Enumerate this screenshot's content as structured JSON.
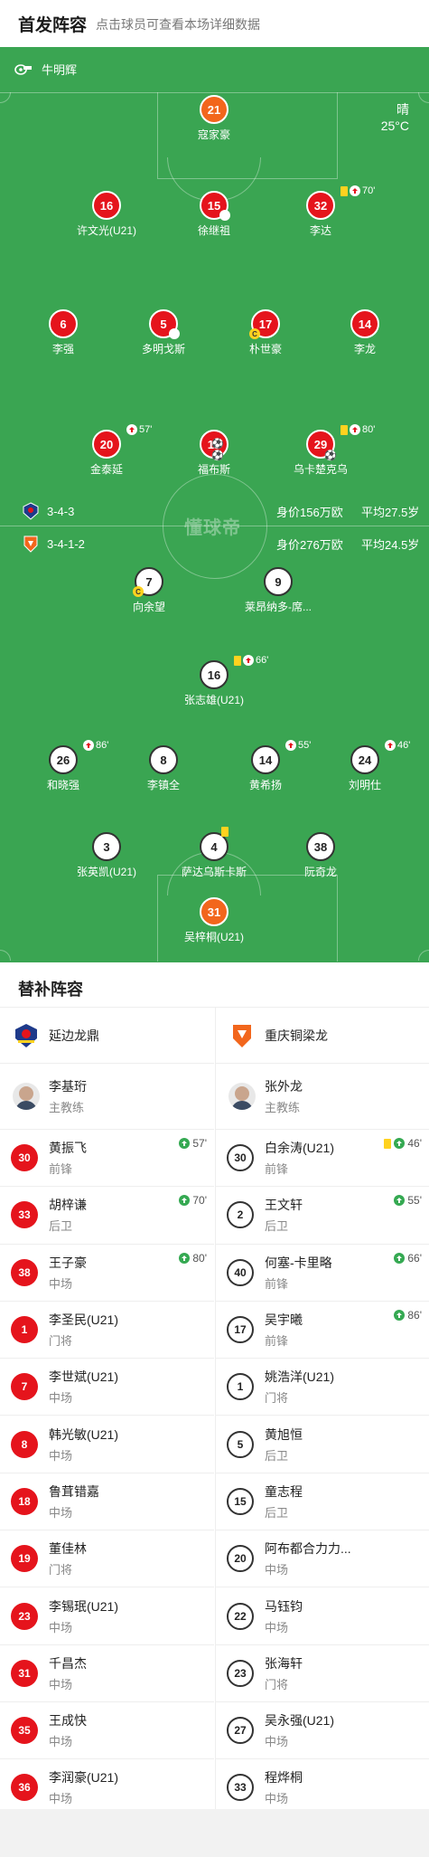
{
  "header": {
    "title": "首发阵容",
    "subtitle": "点击球员可查看本场详细数据"
  },
  "pitch": {
    "referee": "牛明辉",
    "weather": "晴",
    "temperature": "25°C",
    "watermark": "懂球帝",
    "home_team": {
      "formation": "3-4-3",
      "value": "身价156万欧",
      "age": "平均27.5岁"
    },
    "away_team": {
      "formation": "3-4-1-2",
      "value": "身价276万欧",
      "age": "平均24.5岁"
    }
  },
  "home_lineup": [
    {
      "num": "21",
      "name": "寇家豪",
      "color": "orange"
    },
    {
      "num": "16",
      "name": "许文光(U21)",
      "color": "red"
    },
    {
      "num": "15",
      "name": "徐继祖",
      "color": "red",
      "sub_mark": true
    },
    {
      "num": "32",
      "name": "李达",
      "color": "red",
      "yellow": true,
      "sub_time": "70'"
    },
    {
      "num": "6",
      "name": "李强",
      "color": "red"
    },
    {
      "num": "5",
      "name": "多明戈斯",
      "color": "red",
      "sub_mark": true
    },
    {
      "num": "17",
      "name": "朴世豪",
      "color": "red",
      "captain": "C"
    },
    {
      "num": "14",
      "name": "李龙",
      "color": "red"
    },
    {
      "num": "20",
      "name": "金泰延",
      "color": "red",
      "sub_time": "57'"
    },
    {
      "num": "10",
      "name": "福布斯",
      "color": "red",
      "goals": "⚽⚽"
    },
    {
      "num": "29",
      "name": "乌卡楚克乌",
      "color": "red",
      "yellow": true,
      "sub_time": "80'",
      "goals": "⚽"
    }
  ],
  "away_lineup": [
    {
      "num": "7",
      "name": "向余望",
      "captain": "C"
    },
    {
      "num": "9",
      "name": "莱昂纳多-席..."
    },
    {
      "num": "16",
      "name": "张志雄(U21)",
      "yellow": true,
      "sub_time": "66'"
    },
    {
      "num": "26",
      "name": "和晓强",
      "sub_time": "86'"
    },
    {
      "num": "8",
      "name": "李镇全"
    },
    {
      "num": "14",
      "name": "黄希扬",
      "sub_time": "55'"
    },
    {
      "num": "24",
      "name": "刘明仕",
      "sub_time": "46'"
    },
    {
      "num": "3",
      "name": "张英凯(U21)"
    },
    {
      "num": "4",
      "name": "萨达乌斯卡斯",
      "yellow": true
    },
    {
      "num": "38",
      "name": "阮奇龙"
    },
    {
      "num": "31",
      "name": "吴梓桐(U21)",
      "color": "orange"
    }
  ],
  "substitutes": {
    "title": "替补阵容",
    "home": {
      "team": "延边龙鼎",
      "coach": {
        "name": "李基珩",
        "role": "主教练"
      },
      "players": [
        {
          "num": "30",
          "name": "黄振飞",
          "pos": "前锋",
          "in": "57'"
        },
        {
          "num": "33",
          "name": "胡梓谦",
          "pos": "后卫",
          "in": "70'"
        },
        {
          "num": "38",
          "name": "王子豪",
          "pos": "中场",
          "in": "80'"
        },
        {
          "num": "1",
          "name": "李圣民(U21)",
          "pos": "门将"
        },
        {
          "num": "7",
          "name": "李世斌(U21)",
          "pos": "中场"
        },
        {
          "num": "8",
          "name": "韩光敏(U21)",
          "pos": "中场"
        },
        {
          "num": "18",
          "name": "鲁茸错嘉",
          "pos": "中场"
        },
        {
          "num": "19",
          "name": "董佳林",
          "pos": "门将"
        },
        {
          "num": "23",
          "name": "李锡珉(U21)",
          "pos": "中场"
        },
        {
          "num": "31",
          "name": "千昌杰",
          "pos": "中场"
        },
        {
          "num": "35",
          "name": "王成快",
          "pos": "中场"
        },
        {
          "num": "36",
          "name": "李润豪(U21)",
          "pos": "中场"
        }
      ]
    },
    "away": {
      "team": "重庆铜梁龙",
      "coach": {
        "name": "张外龙",
        "role": "主教练"
      },
      "players": [
        {
          "num": "30",
          "name": "白余涛(U21)",
          "pos": "前锋",
          "in": "46'",
          "yellow": true
        },
        {
          "num": "2",
          "name": "王文轩",
          "pos": "后卫",
          "in": "55'"
        },
        {
          "num": "40",
          "name": "何塞-卡里略",
          "pos": "前锋",
          "in": "66'"
        },
        {
          "num": "17",
          "name": "吴宇曦",
          "pos": "前锋",
          "in": "86'"
        },
        {
          "num": "1",
          "name": "姚浩洋(U21)",
          "pos": "门将"
        },
        {
          "num": "5",
          "name": "黄旭恒",
          "pos": "后卫"
        },
        {
          "num": "15",
          "name": "童志程",
          "pos": "后卫"
        },
        {
          "num": "20",
          "name": "阿布都合力力...",
          "pos": "中场"
        },
        {
          "num": "22",
          "name": "马钰钧",
          "pos": "中场"
        },
        {
          "num": "23",
          "name": "张海轩",
          "pos": "门将"
        },
        {
          "num": "27",
          "name": "吴永强(U21)",
          "pos": "中场"
        },
        {
          "num": "33",
          "name": "程烨桐",
          "pos": "中场"
        }
      ]
    }
  }
}
